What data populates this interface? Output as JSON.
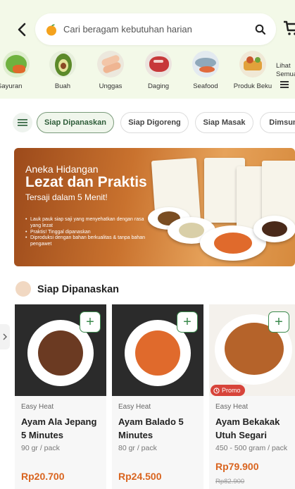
{
  "search": {
    "placeholder": "Cari beragam kebutuhan harian"
  },
  "categories": [
    {
      "label": "Sayuran",
      "icon": "vegetable-icon"
    },
    {
      "label": "Buah",
      "icon": "avocado-icon"
    },
    {
      "label": "Unggas",
      "icon": "chicken-icon"
    },
    {
      "label": "Daging",
      "icon": "meat-icon"
    },
    {
      "label": "Seafood",
      "icon": "fish-icon"
    },
    {
      "label": "Produk Beku",
      "icon": "frozen-food-icon"
    },
    {
      "label": "Lihat Semua",
      "icon": "menu-icon"
    }
  ],
  "chips": [
    "Siap Dipanaskan",
    "Siap Digoreng",
    "Siap Masak",
    "Dimsum"
  ],
  "banner": {
    "line1": "Aneka Hidangan",
    "line2": "Lezat dan Praktis",
    "line3": "Tersaji dalam 5 Menit!",
    "bullets": [
      "Lauk pauk siap saji yang menyehatkan dengan rasa yang lezat",
      "Praktis! Tinggal dipanaskan",
      "Diproduksi dengan bahan berkualitas & tanpa bahan pengawet"
    ]
  },
  "section": {
    "title": "Siap Dipanaskan"
  },
  "products": [
    {
      "tag": "Easy Heat",
      "name": "Ayam Ala Jepang 5 Minutes",
      "weight": "90 gr / pack",
      "price": "Rp20.700",
      "food_color": "#6b3a22"
    },
    {
      "tag": "Easy Heat",
      "name": "Ayam Balado 5 Minutes",
      "weight": "80 gr / pack",
      "price": "Rp24.500",
      "food_color": "#e06a2c"
    },
    {
      "tag": "Easy Heat",
      "name": "Ayam Bekakak Utuh Segari",
      "weight": "450 - 500 gram / pack",
      "price": "Rp79.900",
      "old_price": "Rp82.900",
      "promo": "Promo",
      "food_color": "#b5632a"
    }
  ],
  "colors": {
    "accent": "#3b8a4d",
    "price": "#d9641f",
    "promo": "#d7443a",
    "header_bg": "#f3f9e8"
  }
}
